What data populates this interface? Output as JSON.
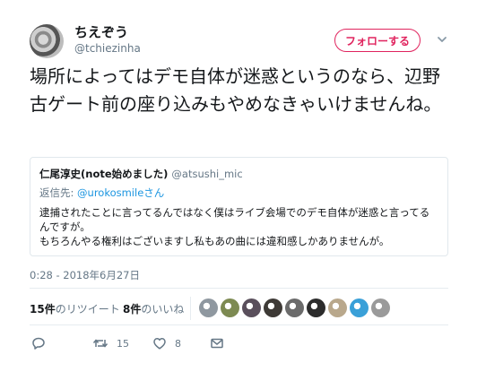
{
  "author": {
    "display_name": "ちえぞう",
    "handle": "@tchiezinha"
  },
  "follow_button": {
    "label": "フォロー",
    "label_suffix": "する"
  },
  "tweet": {
    "text": "場所によってはデモ自体が迷惑というのなら、辺野古ゲート前の座り込みもやめなきゃいけませんね。"
  },
  "quote": {
    "name": "仁尾淳史(note始めました)",
    "handle": "@atsushi_mic",
    "reply_prefix": "返信先:",
    "reply_to": "@urokosmileさん",
    "text": "逮捕されたことに言ってるんではなく僕はライブ会場でのデモ自体が迷惑と言ってるんですが。\nもちろんやる権利はございますし私もあの曲には違和感しかありませんが。"
  },
  "timestamp": "0:28 - 2018年6月27日",
  "stats": {
    "retweets_count": "15件",
    "retweets_label": "のリツイート",
    "likes_count": "8件",
    "likes_label": "のいいね"
  },
  "liker_avatars": [
    "#8f98a0",
    "#7d8a52",
    "#5a4f5c",
    "#3e3a36",
    "#6b6b6b",
    "#2c2c2c",
    "#b9a88c",
    "#3aa0d8",
    "#9a9a9a"
  ],
  "actions": {
    "reply_count": "",
    "retweet_count": "15",
    "like_count": "8"
  },
  "icons": [
    "chevron-down-icon",
    "reply-icon",
    "retweet-icon",
    "heart-icon",
    "message-icon"
  ],
  "colors": {
    "accent": "#e0245e",
    "link": "#1b95e0",
    "muted": "#657786"
  }
}
